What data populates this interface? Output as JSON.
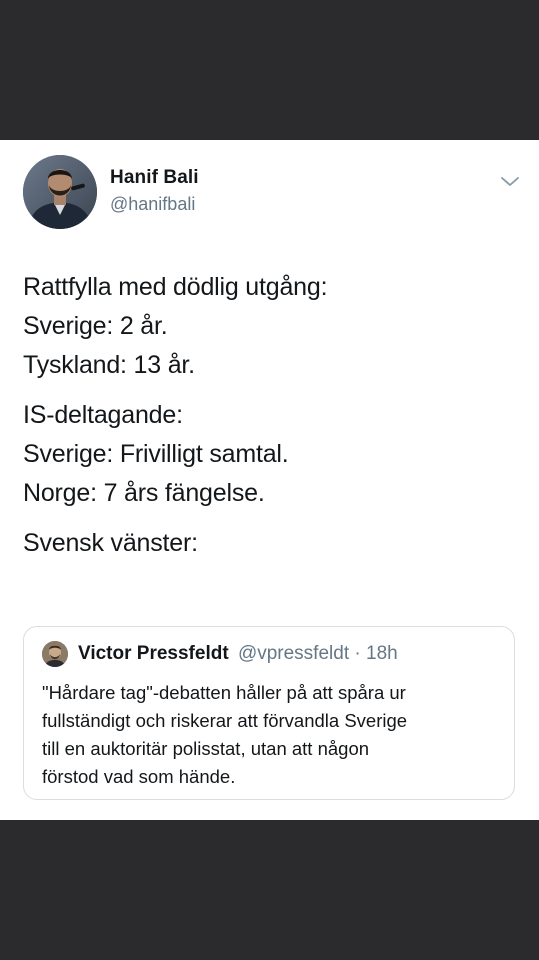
{
  "tweet": {
    "author": {
      "name": "Hanif Bali",
      "handle": "@hanifbali",
      "avatar_icon": "profile-photo"
    },
    "menu_icon": "chevron-down-icon",
    "paragraphs": [
      [
        "Rattfylla med dödlig utgång:",
        "Sverige: 2 år.",
        "Tyskland: 13 år."
      ],
      [
        "IS-deltagande:",
        "Sverige: Frivilligt samtal.",
        "Norge: 7 års fängelse."
      ],
      [
        "Svensk vänster:"
      ]
    ],
    "quoted_tweet": {
      "name": "Victor Pressfeldt",
      "handle": "@vpressfeldt",
      "separator": "·",
      "time": "18h",
      "lines": [
        "\"Hårdare tag\"-debatten håller på att spåra ur",
        "fullständigt och riskerar att förvandla Sverige",
        "till en auktoritär polisstat, utan att någon",
        "förstod vad som hände."
      ]
    }
  },
  "colors": {
    "background_dark": "#2b2b2d",
    "card": "#ffffff",
    "text_primary": "#14171a",
    "text_secondary": "#657786",
    "border": "#d8dee3"
  }
}
